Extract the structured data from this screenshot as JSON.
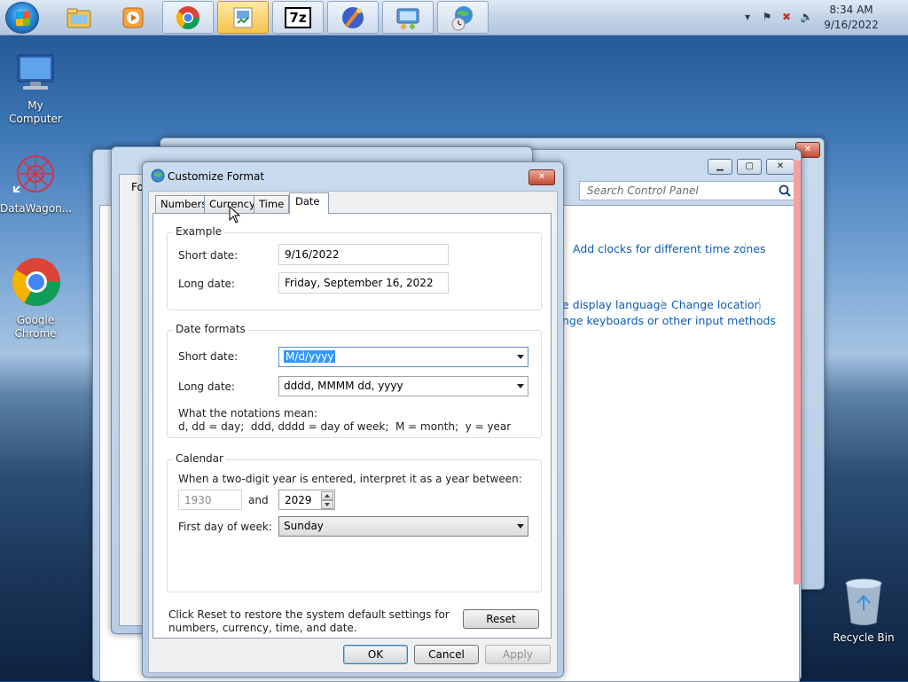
{
  "taskbar": {
    "clock_time": "8:34 AM",
    "clock_date": "9/16/2022",
    "buttons": [
      "explorer-icon",
      "media-player-icon",
      "chrome-icon",
      "control-panel-icon",
      "7zip-icon",
      "app-icon",
      "network-icon",
      "clock-region-icon"
    ],
    "sevenzip_label": "7z"
  },
  "desktop": {
    "icons": [
      {
        "label": "My Computer"
      },
      {
        "label": "DataWagon..."
      },
      {
        "label": "Google Chrome"
      },
      {
        "label": "Recycle Bin"
      }
    ]
  },
  "control_panel": {
    "search_placeholder": "Search Control Panel",
    "links": {
      "add_clocks": "Add clocks for different time zones",
      "display_language": "e display language",
      "change_location": "Change location",
      "keyboards": "nge keyboards or other input methods"
    }
  },
  "background_window": {
    "partial_label": "Fo"
  },
  "dialog": {
    "title": "Customize Format",
    "tabs": [
      "Numbers",
      "Currency",
      "Time",
      "Date"
    ],
    "selected_tab": "Date",
    "example": {
      "title": "Example",
      "short_label": "Short date:",
      "short_value": "9/16/2022",
      "long_label": "Long date:",
      "long_value": "Friday, September 16, 2022"
    },
    "formats": {
      "title": "Date formats",
      "short_label": "Short date:",
      "short_value": "M/d/yyyy",
      "long_label": "Long date:",
      "long_value": "dddd, MMMM dd, yyyy",
      "notation_header": "What the notations mean:",
      "notation_text": "d, dd = day;  ddd, dddd = day of week;  M = month;  y = year"
    },
    "calendar": {
      "title": "Calendar",
      "two_digit_text": "When a two-digit year is entered, interpret it as a year between:",
      "year_from": "1930",
      "and_label": "and",
      "year_to": "2029",
      "first_day_label": "First day of week:",
      "first_day_value": "Sunday"
    },
    "reset_text_line1": "Click Reset to restore the system default settings for",
    "reset_text_line2": "numbers, currency, time, and date.",
    "reset_label": "Reset",
    "ok_label": "OK",
    "cancel_label": "Cancel",
    "apply_label": "Apply"
  }
}
